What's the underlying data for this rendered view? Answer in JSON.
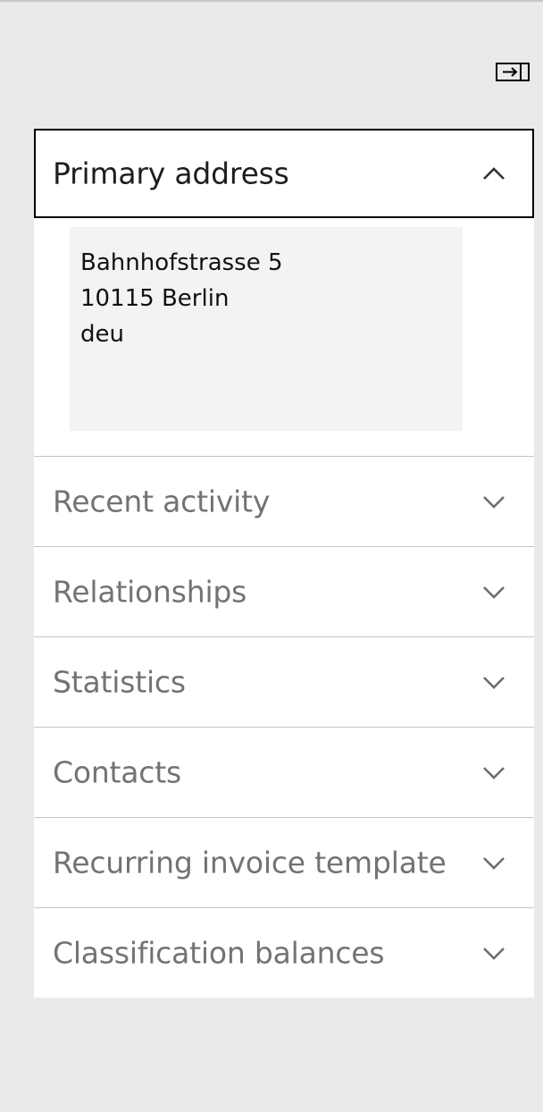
{
  "factbox": {
    "toggle_icon": "collapse-pane-icon",
    "sections": [
      {
        "title": "Primary address",
        "expanded": true,
        "address_lines": [
          "Bahnhofstrasse 5",
          "10115 Berlin",
          "deu"
        ]
      },
      {
        "title": "Recent activity",
        "expanded": false
      },
      {
        "title": "Relationships",
        "expanded": false
      },
      {
        "title": "Statistics",
        "expanded": false
      },
      {
        "title": "Contacts",
        "expanded": false
      },
      {
        "title": "Recurring invoice template",
        "expanded": false
      },
      {
        "title": "Classification balances",
        "expanded": false
      }
    ]
  },
  "colors": {
    "background": "#eaeaea",
    "panel": "#ffffff",
    "address_box": "#f3f3f3",
    "divider": "#c6c6c6",
    "muted_text": "#737373",
    "focus_border": "#000000"
  }
}
